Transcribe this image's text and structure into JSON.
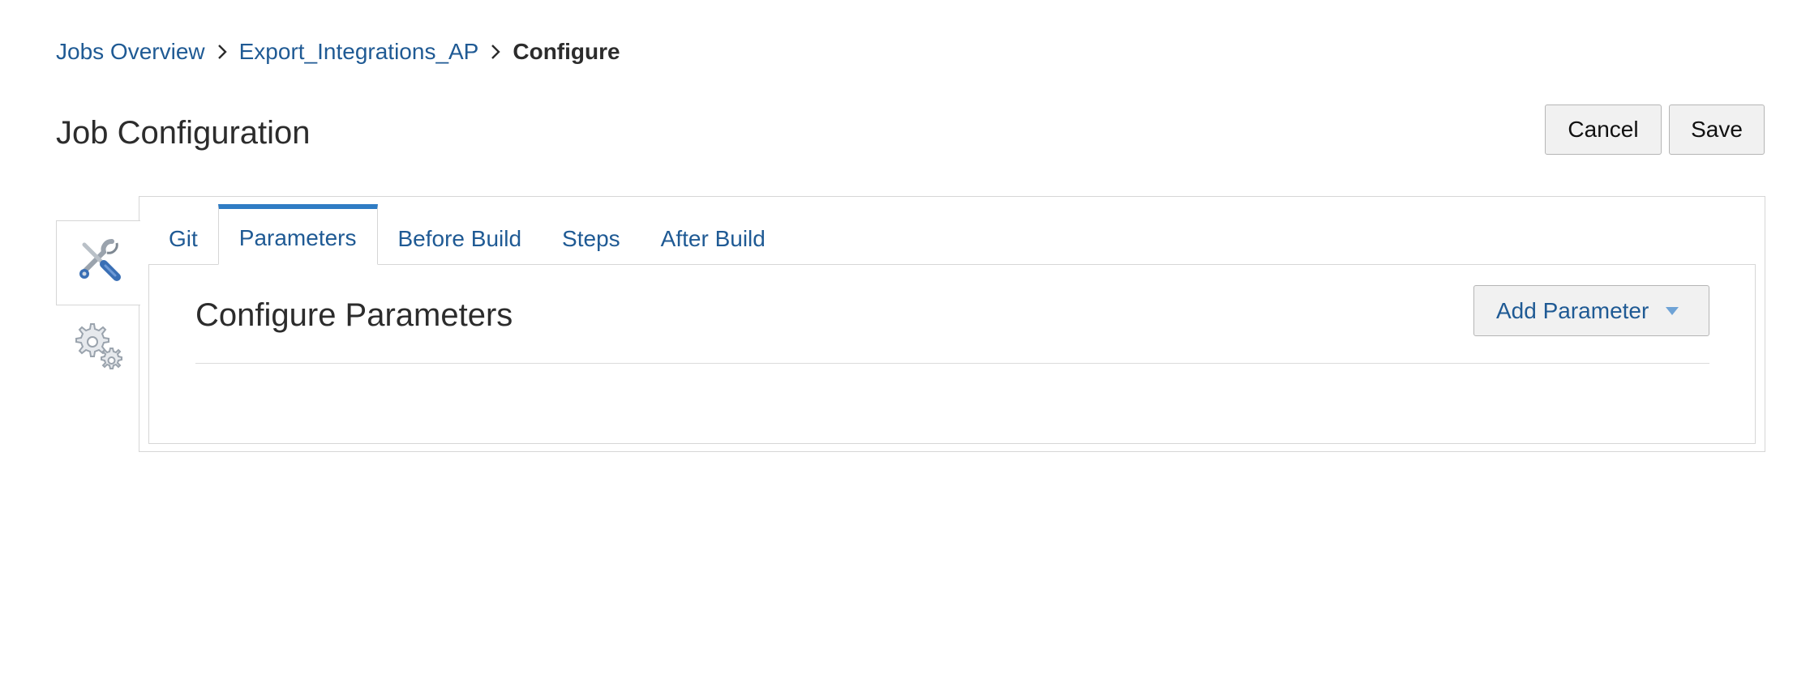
{
  "breadcrumb": {
    "items": [
      {
        "label": "Jobs Overview"
      },
      {
        "label": "Export_Integrations_AP"
      }
    ],
    "current": "Configure"
  },
  "page": {
    "title": "Job Configuration"
  },
  "actions": {
    "cancel_label": "Cancel",
    "save_label": "Save"
  },
  "side_nav": {
    "items": [
      {
        "icon": "tools-icon",
        "active": true
      },
      {
        "icon": "gears-icon",
        "active": false
      }
    ]
  },
  "tabs": [
    {
      "label": "Git",
      "active": false
    },
    {
      "label": "Parameters",
      "active": true
    },
    {
      "label": "Before Build",
      "active": false
    },
    {
      "label": "Steps",
      "active": false
    },
    {
      "label": "After Build",
      "active": false
    }
  ],
  "parameters": {
    "title": "Configure Parameters",
    "add_button_label": "Add Parameter",
    "add_button_icon": "caret-down-icon"
  },
  "colors": {
    "link": "#1f5a94",
    "active_tab_accent": "#2f7cc4",
    "border": "#d6d6d6",
    "button_bg": "#f1f1f1"
  }
}
